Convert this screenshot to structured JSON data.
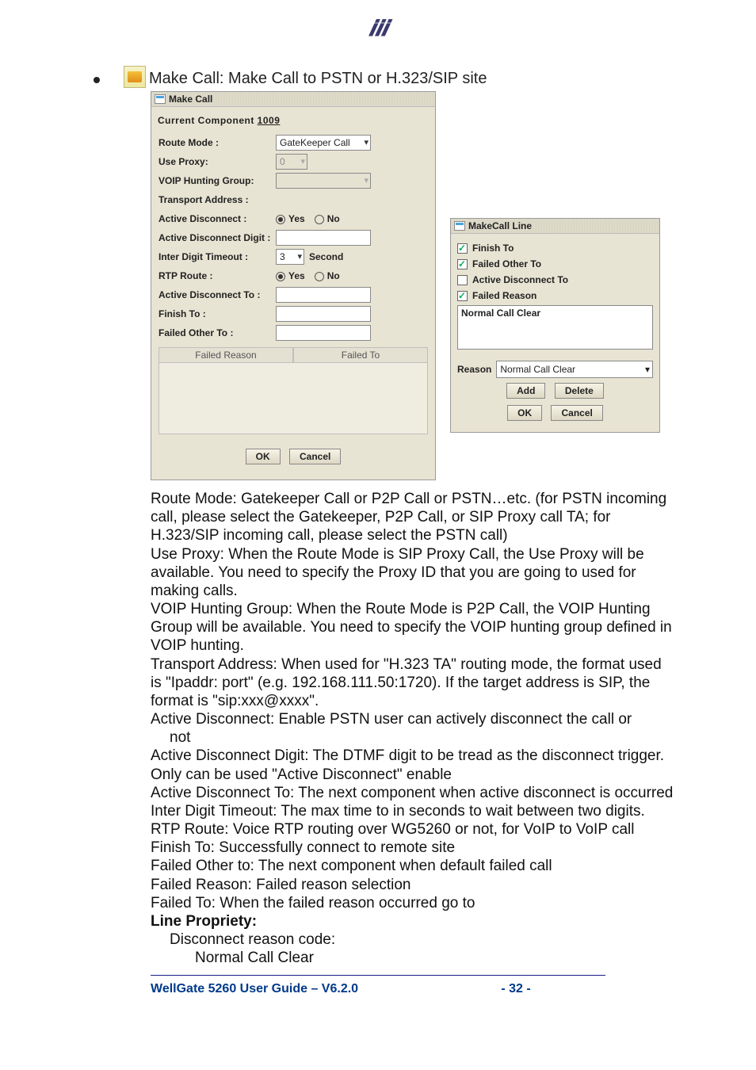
{
  "section_title": "Make Call: Make Call to PSTN or H.323/SIP site",
  "make_call_panel": {
    "title": "Make Call",
    "component_prefix": "Current Component",
    "component_id": "1009",
    "fields": {
      "route_mode_label": "Route Mode :",
      "route_mode_value": "GateKeeper Call",
      "use_proxy_label": "Use Proxy:",
      "use_proxy_value": "0",
      "voip_hunting_label": "VOIP Hunting Group:",
      "transport_address_label": "Transport Address :",
      "active_disconnect_label": "Active Disconnect :",
      "yes": "Yes",
      "no": "No",
      "active_disconnect_digit_label": "Active Disconnect Digit :",
      "inter_digit_timeout_label": "Inter Digit Timeout :",
      "inter_digit_timeout_value": "3",
      "inter_digit_timeout_unit": "Second",
      "rtp_route_label": "RTP Route :",
      "active_disconnect_to_label": "Active Disconnect To :",
      "finish_to_label": "Finish To :",
      "failed_other_to_label": "Failed Other To :",
      "table_col1": "Failed Reason",
      "table_col2": "Failed To",
      "ok": "OK",
      "cancel": "Cancel"
    }
  },
  "makecall_line_panel": {
    "title": "MakeCall Line",
    "finish_to": "Finish To",
    "failed_other_to": "Failed Other To",
    "active_disconnect_to": "Active Disconnect To",
    "failed_reason": "Failed Reason",
    "text_value": "Normal Call Clear",
    "reason_label": "Reason",
    "reason_value": "Normal Call Clear",
    "add": "Add",
    "delete": "Delete",
    "ok": "OK",
    "cancel": "Cancel"
  },
  "doc": {
    "p1": " Route Mode: Gatekeeper Call or P2P Call or PSTN…etc. (for PSTN incoming call, please select the Gatekeeper, P2P Call, or SIP Proxy call TA; for H.323/SIP incoming call, please select the PSTN call)",
    "p2": " Use Proxy: When the Route Mode is SIP Proxy Call, the Use Proxy will be available. You need to specify the Proxy ID that you are going to used for making calls.",
    "p3": " VOIP Hunting Group: When the Route Mode is P2P Call, the VOIP Hunting Group will be available. You need to specify the VOIP hunting group defined in VOIP hunting.",
    "p4": " Transport Address: When used for \"H.323 TA\" routing mode, the format used is \"Ipaddr: port\" (e.g. 192.168.111.50:1720). If the target address is SIP, the format is \"sip:xxx@xxxx\".",
    "p5": " Active Disconnect: Enable PSTN user can actively disconnect the call or",
    "p5b": "not",
    "p6": " Active Disconnect Digit: The DTMF digit to be tread as the disconnect trigger. Only can be used \"Active Disconnect\" enable",
    "p7": " Active Disconnect To: The next component when active disconnect is occurred",
    "p8": " Inter Digit Timeout: The max time to in seconds to wait between two digits.",
    "p9": " RTP Route: Voice RTP routing over WG5260 or not, for VoIP to VoIP call",
    "p10": " Finish To: Successfully connect to remote site",
    "p11": " Failed Other to: The next component when default failed call",
    "p12": " Failed Reason: Failed reason selection",
    "p13": " Failed To: When the failed reason occurred go to",
    "p14": "Line Propriety:",
    "p15": "Disconnect reason code:",
    "p16": "Normal Call Clear"
  },
  "footer": {
    "left": "WellGate 5260 User Guide – V6.2.0",
    "page": "- 32 -"
  }
}
